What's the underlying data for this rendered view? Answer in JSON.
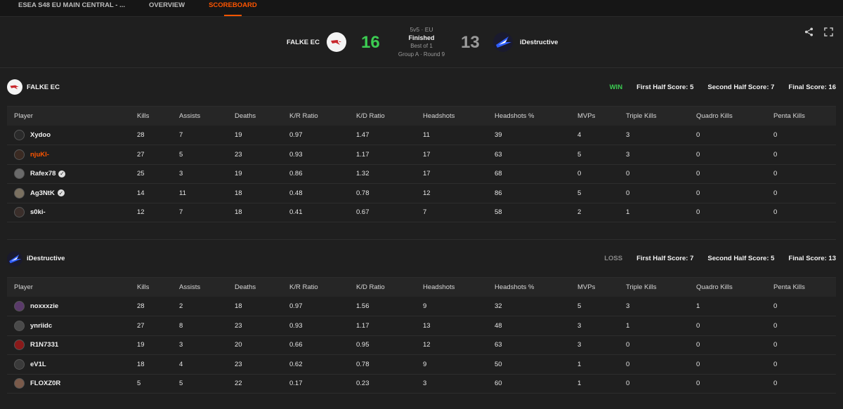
{
  "tabs": [
    {
      "label": "ESEA S48 EU MAIN CENTRAL - ..."
    },
    {
      "label": "OVERVIEW"
    },
    {
      "label": "SCOREBOARD",
      "active": true
    }
  ],
  "match": {
    "team1_name": "FALKE EC",
    "team2_name": "iDestructive",
    "team1_score": "16",
    "team2_score": "13",
    "format": "5v5 · EU",
    "status": "Finished",
    "best_of": "Best of 1",
    "stage": "Group A · Round 9"
  },
  "icons": {
    "share": "share-icon",
    "fullscreen": "fullscreen-icon"
  },
  "colors": {
    "accent": "#ff5500",
    "win": "#3ccc52",
    "loss": "#8a8a8a"
  },
  "columns": [
    "Player",
    "Kills",
    "Assists",
    "Deaths",
    "K/R Ratio",
    "K/D Ratio",
    "Headshots",
    "Headshots %",
    "MVPs",
    "Triple Kills",
    "Quadro Kills",
    "Penta Kills"
  ],
  "team1": {
    "name": "FALKE EC",
    "result": "WIN",
    "first_half": "First Half Score: 5",
    "second_half": "Second Half Score: 7",
    "final": "Final Score: 16",
    "players": [
      {
        "name": "Xydoo",
        "verified": false,
        "highlight": false,
        "avatar_color": "#2a2a2a",
        "stats": [
          "28",
          "7",
          "19",
          "0.97",
          "1.47",
          "11",
          "39",
          "4",
          "3",
          "0",
          "0"
        ]
      },
      {
        "name": "njuKI-",
        "verified": false,
        "highlight": true,
        "avatar_color": "#3a2a22",
        "stats": [
          "27",
          "5",
          "23",
          "0.93",
          "1.17",
          "17",
          "63",
          "5",
          "3",
          "0",
          "0"
        ]
      },
      {
        "name": "Rafex78",
        "verified": true,
        "highlight": false,
        "avatar_color": "#6a6a6a",
        "stats": [
          "25",
          "3",
          "19",
          "0.86",
          "1.32",
          "17",
          "68",
          "0",
          "0",
          "0",
          "0"
        ]
      },
      {
        "name": "Ag3NtK",
        "verified": true,
        "highlight": false,
        "avatar_color": "#7a7060",
        "stats": [
          "14",
          "11",
          "18",
          "0.48",
          "0.78",
          "12",
          "86",
          "5",
          "0",
          "0",
          "0"
        ]
      },
      {
        "name": "s0ki-",
        "verified": false,
        "highlight": false,
        "avatar_color": "#3a2e2a",
        "stats": [
          "12",
          "7",
          "18",
          "0.41",
          "0.67",
          "7",
          "58",
          "2",
          "1",
          "0",
          "0"
        ]
      }
    ]
  },
  "team2": {
    "name": "iDestructive",
    "result": "LOSS",
    "first_half": "First Half Score: 7",
    "second_half": "Second Half Score: 5",
    "final": "Final Score: 13",
    "players": [
      {
        "name": "noxxxzie",
        "verified": false,
        "highlight": false,
        "avatar_color": "#5a3a6a",
        "stats": [
          "28",
          "2",
          "18",
          "0.97",
          "1.56",
          "9",
          "32",
          "5",
          "3",
          "1",
          "0"
        ]
      },
      {
        "name": "ynriidc",
        "verified": false,
        "highlight": false,
        "avatar_color": "#4a4a4a",
        "stats": [
          "27",
          "8",
          "23",
          "0.93",
          "1.17",
          "13",
          "48",
          "3",
          "1",
          "0",
          "0"
        ]
      },
      {
        "name": "R1N7331",
        "verified": false,
        "highlight": false,
        "avatar_color": "#8a1a1a",
        "stats": [
          "19",
          "3",
          "20",
          "0.66",
          "0.95",
          "12",
          "63",
          "3",
          "0",
          "0",
          "0"
        ]
      },
      {
        "name": "eV1L",
        "verified": false,
        "highlight": false,
        "avatar_color": "#3a3a3a",
        "stats": [
          "18",
          "4",
          "23",
          "0.62",
          "0.78",
          "9",
          "50",
          "1",
          "0",
          "0",
          "0"
        ]
      },
      {
        "name": "FLOXZ0R",
        "verified": false,
        "highlight": false,
        "avatar_color": "#7a5a4a",
        "stats": [
          "5",
          "5",
          "22",
          "0.17",
          "0.23",
          "3",
          "60",
          "1",
          "0",
          "0",
          "0"
        ]
      }
    ]
  }
}
